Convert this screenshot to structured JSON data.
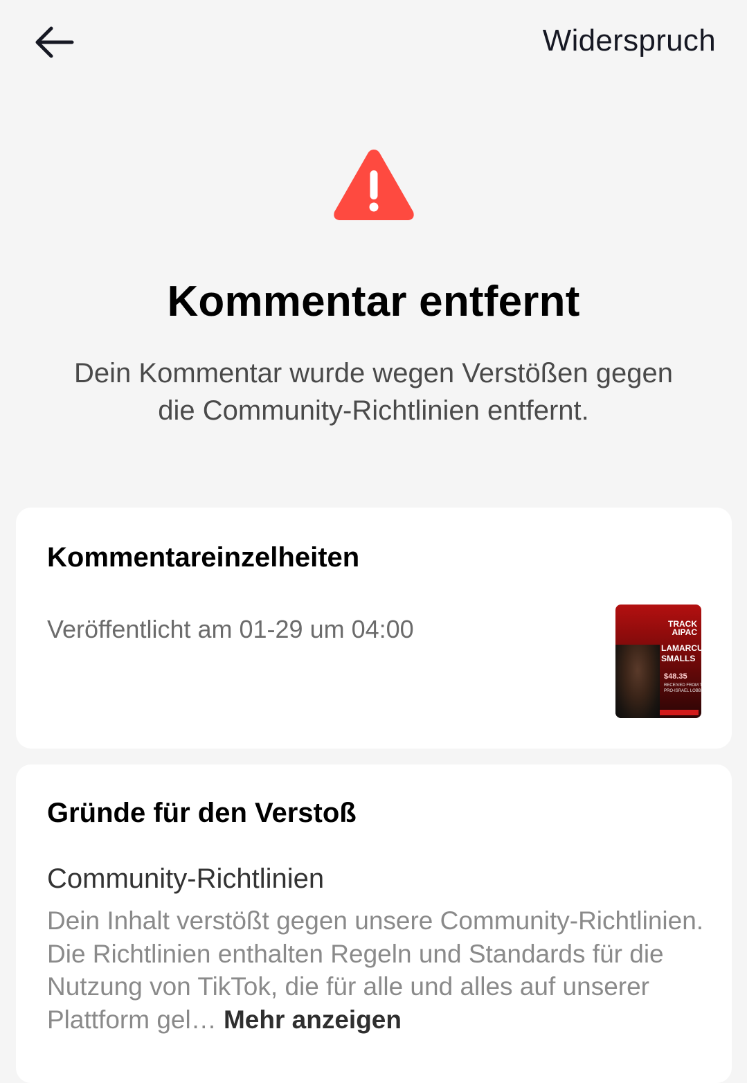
{
  "header": {
    "back_icon": "arrow-left-icon",
    "appeal_label": "Widerspruch"
  },
  "status": {
    "icon": "warning-triangle-icon",
    "icon_color": "#fe4a40",
    "title": "Kommentar entfernt",
    "description": "Dein Kommentar wurde wegen Verstößen gegen die Community-Richtlinien entfernt."
  },
  "comment_details": {
    "title": "Kommentareinzelheiten",
    "published": "Veröffentlicht am 01-29 um 04:00",
    "thumbnail": {
      "logo_line1": "TRACK",
      "logo_line2": "AIPAC",
      "name_line1": "LAMARCUS",
      "name_line2": "SMALLS",
      "amount": "$48.35",
      "note_line1": "RECEIVED FROM T",
      "note_line2": "PRO-ISRAEL LOBB"
    }
  },
  "violation": {
    "title": "Gründe für den Verstoß",
    "policy_name": "Community-Richtlinien",
    "text": "Dein Inhalt verstößt gegen unsere Community-Richtlinien. Die Richtlinien enthalten Regeln und Standards für die Nutzung von TikTok, die für alle und alles auf unserer Plattform gel…",
    "more_label": "Mehr anzeigen"
  }
}
